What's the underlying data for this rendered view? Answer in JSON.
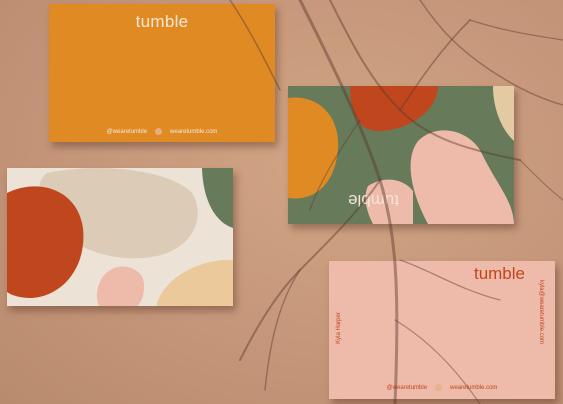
{
  "brand": "tumble",
  "card_front": {
    "handle": "@wearetumble",
    "website": "wearetumble.com"
  },
  "card_pattern_green": {
    "brand": "tumble"
  },
  "card_back_pink": {
    "brand": "tumble",
    "name": "Kyla Harper",
    "email": "kyla@wearetumble.com",
    "handle": "@wearetumble",
    "website": "wearetumble.com"
  },
  "colors": {
    "background": "#c99a7a",
    "orange": "#e08a24",
    "green": "#677a5a",
    "cream": "#ece3d6",
    "pink": "#eebaaa",
    "rust": "#c0471d"
  }
}
